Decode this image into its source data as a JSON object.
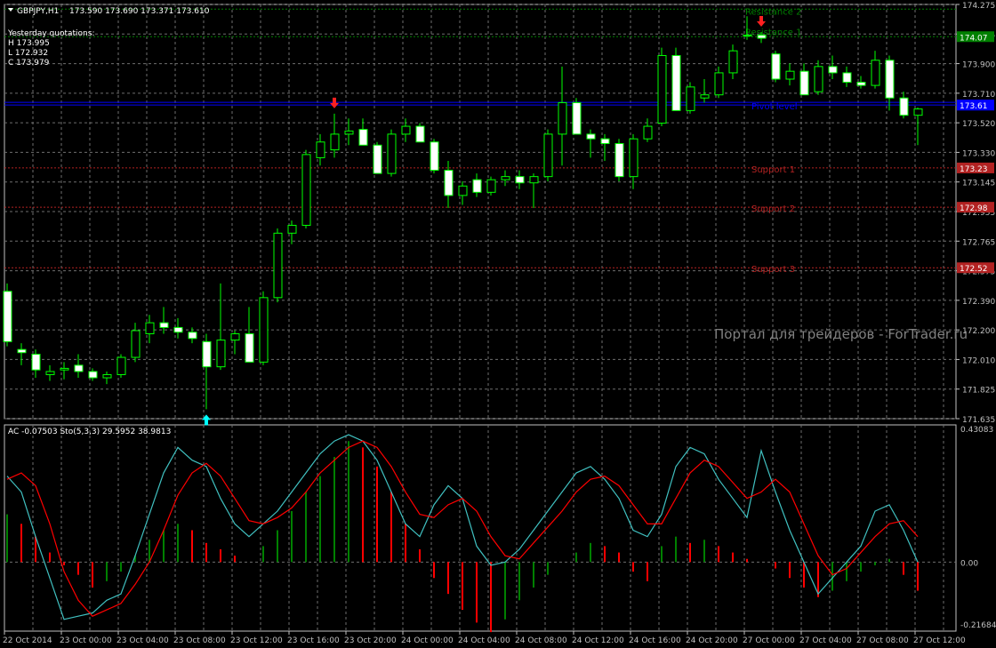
{
  "header": {
    "symbol": "GBPJPY,H1",
    "ohlc": "173.590 173.690 173.371 173.610",
    "yesterday_label": "Yesterday quotations:",
    "high": "H 173.995",
    "low": "L 172.932",
    "close": "C 173.979"
  },
  "watermark": "Портал для трейдеров - ForTrader.ru",
  "colors": {
    "bg": "#000000",
    "grid": "#6e6e6e",
    "axis": "#c0c0c0",
    "bull_body": "#000000",
    "bear_body": "#ffffff",
    "candle_outline": "#00ff00",
    "pivot": "#0000ff",
    "resistance": "#008000",
    "support": "#b22222",
    "ac_up": "#008000",
    "ac_down": "#ff0000",
    "sto_main": "#40c0c0",
    "sto_signal": "#ff0000"
  },
  "chart_data": [
    {
      "type": "candlestick",
      "ylim": [
        171.64,
        174.275
      ],
      "y_ticks": [
        "174.275",
        "174.085",
        "173.900",
        "173.710",
        "173.520",
        "173.330",
        "173.145",
        "172.955",
        "172.765",
        "172.575",
        "172.390",
        "172.200",
        "172.010",
        "171.825",
        "171.635"
      ],
      "x_ticks": [
        "22 Oct 2014",
        "23 Oct 00:00",
        "23 Oct 04:00",
        "23 Oct 08:00",
        "23 Oct 12:00",
        "23 Oct 16:00",
        "23 Oct 20:00",
        "24 Oct 00:00",
        "24 Oct 04:00",
        "24 Oct 08:00",
        "24 Oct 12:00",
        "24 Oct 16:00",
        "24 Oct 20:00",
        "27 Oct 00:00",
        "27 Oct 04:00",
        "27 Oct 08:00",
        "27 Oct 12:00"
      ],
      "candles": [
        [
          172.45,
          172.5,
          172.1,
          172.13
        ],
        [
          172.08,
          172.12,
          171.98,
          172.06
        ],
        [
          172.05,
          172.08,
          171.9,
          171.95
        ],
        [
          171.92,
          171.98,
          171.88,
          171.94
        ],
        [
          171.95,
          172.0,
          171.89,
          171.96
        ],
        [
          171.98,
          172.05,
          171.9,
          171.94
        ],
        [
          171.94,
          171.96,
          171.88,
          171.9
        ],
        [
          171.9,
          171.94,
          171.86,
          171.92
        ],
        [
          171.92,
          172.05,
          171.9,
          172.03
        ],
        [
          172.03,
          172.25,
          172.0,
          172.2
        ],
        [
          172.18,
          172.3,
          172.12,
          172.25
        ],
        [
          172.25,
          172.35,
          172.18,
          172.22
        ],
        [
          172.22,
          172.28,
          172.15,
          172.19
        ],
        [
          172.19,
          172.22,
          172.12,
          172.15
        ],
        [
          172.13,
          172.18,
          171.7,
          171.97
        ],
        [
          171.97,
          172.5,
          171.95,
          172.14
        ],
        [
          172.14,
          172.2,
          172.05,
          172.18
        ],
        [
          172.18,
          172.35,
          172.0,
          172.0
        ],
        [
          172.0,
          172.45,
          171.98,
          172.41
        ],
        [
          172.41,
          172.85,
          172.38,
          172.82
        ],
        [
          172.82,
          172.9,
          172.75,
          172.87
        ],
        [
          172.87,
          173.35,
          172.85,
          173.32
        ],
        [
          173.3,
          173.45,
          173.25,
          173.4
        ],
        [
          173.35,
          173.58,
          173.3,
          173.45
        ],
        [
          173.45,
          173.55,
          173.38,
          173.47
        ],
        [
          173.48,
          173.55,
          173.4,
          173.38
        ],
        [
          173.38,
          173.4,
          173.2,
          173.2
        ],
        [
          173.2,
          173.48,
          173.18,
          173.45
        ],
        [
          173.45,
          173.55,
          173.4,
          173.5
        ],
        [
          173.5,
          173.52,
          173.4,
          173.4
        ],
        [
          173.4,
          173.42,
          173.2,
          173.22
        ],
        [
          173.22,
          173.28,
          172.98,
          173.06
        ],
        [
          173.06,
          173.15,
          173.0,
          173.12
        ],
        [
          173.16,
          173.2,
          173.05,
          173.08
        ],
        [
          173.08,
          173.18,
          173.06,
          173.16
        ],
        [
          173.16,
          173.22,
          173.12,
          173.18
        ],
        [
          173.18,
          173.22,
          173.1,
          173.14
        ],
        [
          173.14,
          173.2,
          172.98,
          173.18
        ],
        [
          173.18,
          173.48,
          173.15,
          173.45
        ],
        [
          173.45,
          173.88,
          173.25,
          173.65
        ],
        [
          173.65,
          173.68,
          173.45,
          173.45
        ],
        [
          173.45,
          173.48,
          173.3,
          173.42
        ],
        [
          173.42,
          173.45,
          173.28,
          173.39
        ],
        [
          173.39,
          173.42,
          173.15,
          173.18
        ],
        [
          173.18,
          173.45,
          173.1,
          173.42
        ],
        [
          173.42,
          173.55,
          173.4,
          173.5
        ],
        [
          173.52,
          174.0,
          173.5,
          173.95
        ],
        [
          173.95,
          174.0,
          173.6,
          173.6
        ],
        [
          173.6,
          173.78,
          173.58,
          173.75
        ],
        [
          173.68,
          173.8,
          173.65,
          173.7
        ],
        [
          173.7,
          173.88,
          173.68,
          173.84
        ],
        [
          173.84,
          174.02,
          173.8,
          173.98
        ],
        [
          174.08,
          174.2,
          174.05,
          174.08
        ],
        [
          174.08,
          174.1,
          174.03,
          174.06
        ],
        [
          173.96,
          173.98,
          173.78,
          173.8
        ],
        [
          173.8,
          173.9,
          173.76,
          173.85
        ],
        [
          173.85,
          173.9,
          173.7,
          173.7
        ],
        [
          173.72,
          173.92,
          173.7,
          173.88
        ],
        [
          173.88,
          173.95,
          173.8,
          173.84
        ],
        [
          173.84,
          173.88,
          173.75,
          173.78
        ],
        [
          173.78,
          173.82,
          173.74,
          173.76
        ],
        [
          173.76,
          173.98,
          173.74,
          173.92
        ],
        [
          173.92,
          173.95,
          173.6,
          173.68
        ],
        [
          173.68,
          173.72,
          173.55,
          173.57
        ],
        [
          173.57,
          173.62,
          173.38,
          173.61
        ]
      ],
      "levels": [
        {
          "name": "Resistance 2",
          "value": 174.245,
          "kind": "resistance",
          "tag": ""
        },
        {
          "name": "Resistance 1",
          "value": 174.07,
          "kind": "resistance",
          "tag": "174.07"
        },
        {
          "name": "Pivot level",
          "value": 173.635,
          "kind": "pivot",
          "tag": "173.63"
        },
        {
          "name": "Support 1",
          "value": 173.235,
          "kind": "support",
          "tag": "173.23"
        },
        {
          "name": "Support 2",
          "value": 172.985,
          "kind": "support",
          "tag": "172.98"
        },
        {
          "name": "Support 3",
          "value": 172.6,
          "kind": "support",
          "tag": "172.52"
        }
      ],
      "current_price": "173.61",
      "markers": [
        {
          "index": 14,
          "dir": "up",
          "color": "#00ffff"
        },
        {
          "index": 23,
          "dir": "down",
          "color": "#ff2020"
        },
        {
          "index": 53,
          "dir": "down",
          "color": "#ff2020"
        }
      ]
    },
    {
      "type": "indicator",
      "label": "AC -0.07503  Sto(5,3,3) 29.5952 38.9813",
      "ylim": [
        -0.21684,
        0.43083
      ],
      "y_ticks": [
        "0.43083",
        "0.00",
        "-0.21684"
      ],
      "ac": [
        0.15,
        0.12,
        0.08,
        0.03,
        -0.01,
        -0.04,
        -0.08,
        -0.06,
        -0.03,
        0.02,
        0.07,
        0.1,
        0.12,
        0.1,
        0.06,
        0.04,
        0.02,
        0.0,
        0.05,
        0.1,
        0.16,
        0.22,
        0.27,
        0.33,
        0.38,
        0.36,
        0.3,
        0.22,
        0.12,
        0.04,
        -0.05,
        -0.1,
        -0.15,
        -0.19,
        -0.22,
        -0.18,
        -0.12,
        -0.08,
        -0.04,
        0.0,
        0.03,
        0.06,
        0.05,
        0.03,
        -0.03,
        -0.06,
        0.05,
        0.08,
        0.06,
        0.07,
        0.05,
        0.03,
        0.01,
        0.0,
        -0.02,
        -0.05,
        -0.08,
        -0.11,
        -0.09,
        -0.06,
        -0.03,
        -0.01,
        0.01,
        -0.04,
        -0.09
      ],
      "sto_main": [
        0.27,
        0.22,
        0.08,
        -0.05,
        -0.18,
        -0.17,
        -0.16,
        -0.12,
        -0.1,
        0.02,
        0.15,
        0.28,
        0.36,
        0.32,
        0.3,
        0.2,
        0.12,
        0.08,
        0.12,
        0.16,
        0.22,
        0.28,
        0.34,
        0.38,
        0.4,
        0.38,
        0.32,
        0.22,
        0.12,
        0.08,
        0.18,
        0.24,
        0.2,
        0.05,
        -0.01,
        0.0,
        0.04,
        0.1,
        0.16,
        0.22,
        0.28,
        0.3,
        0.26,
        0.2,
        0.1,
        0.08,
        0.15,
        0.3,
        0.36,
        0.34,
        0.26,
        0.2,
        0.14,
        0.35,
        0.22,
        0.1,
        0.0,
        -0.1,
        -0.05,
        0.0,
        0.05,
        0.16,
        0.18,
        0.1,
        0.0
      ],
      "sto_signal": [
        0.26,
        0.28,
        0.24,
        0.12,
        -0.03,
        -0.12,
        -0.17,
        -0.15,
        -0.13,
        -0.07,
        0.0,
        0.1,
        0.21,
        0.28,
        0.31,
        0.27,
        0.2,
        0.13,
        0.12,
        0.14,
        0.17,
        0.22,
        0.28,
        0.32,
        0.36,
        0.38,
        0.36,
        0.3,
        0.22,
        0.15,
        0.14,
        0.18,
        0.2,
        0.16,
        0.08,
        0.02,
        0.01,
        0.06,
        0.11,
        0.16,
        0.22,
        0.26,
        0.27,
        0.24,
        0.18,
        0.12,
        0.12,
        0.2,
        0.28,
        0.32,
        0.3,
        0.25,
        0.2,
        0.22,
        0.26,
        0.22,
        0.12,
        0.02,
        -0.04,
        -0.02,
        0.03,
        0.08,
        0.12,
        0.13,
        0.08
      ]
    }
  ]
}
